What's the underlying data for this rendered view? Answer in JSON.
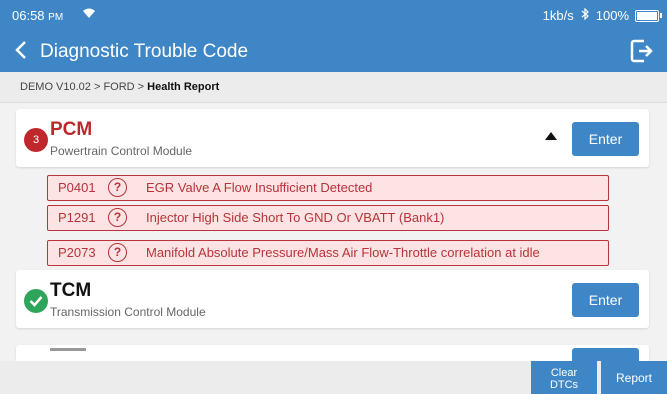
{
  "status_bar": {
    "time": "06:58",
    "ampm": "PM",
    "network_speed": "1kb/s",
    "bluetooth_icon": "bluetooth-icon",
    "battery": "100%"
  },
  "header": {
    "title": "Diagnostic Trouble Code",
    "back_icon": "chevron-left-icon",
    "exit_icon": "exit-icon"
  },
  "breadcrumb": {
    "path": "DEMO V10.02 > FORD > ",
    "current": "Health Report"
  },
  "modules": [
    {
      "name": "PCM",
      "description": "Powertrain Control Module",
      "dtc_count": "3",
      "status": "fault",
      "enter_label": "Enter",
      "codes": [
        {
          "code": "P0401",
          "help": "?",
          "description": "EGR Valve A Flow Insufficient Detected"
        },
        {
          "code": "P1291",
          "help": "?",
          "description": "Injector High Side Short To GND Or VBATT (Bank1)"
        },
        {
          "code": "P2073",
          "help": "?",
          "description": "Manifold Absolute Pressure/Mass Air Flow-Throttle correlation at idle"
        }
      ]
    },
    {
      "name": "TCM",
      "description": "Transmission Control Module",
      "status": "ok",
      "enter_label": "Enter"
    }
  ],
  "footer": {
    "clear_line1": "Clear",
    "clear_line2": "DTCs",
    "report": "Report"
  },
  "colors": {
    "accent": "#3f86c6",
    "fault": "#c0272d",
    "ok": "#2fa55b"
  }
}
